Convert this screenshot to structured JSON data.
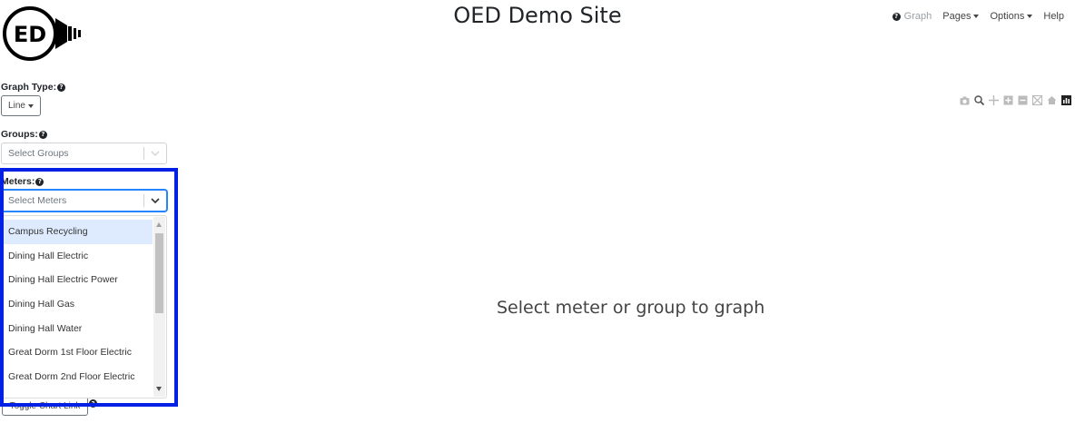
{
  "logo": {
    "text": "ED"
  },
  "header": {
    "title": "OED Demo Site"
  },
  "nav": {
    "items": [
      {
        "label": "Graph",
        "icon": "help-icon",
        "disabled": true
      },
      {
        "label": "Pages",
        "dropdown": true
      },
      {
        "label": "Options",
        "dropdown": true
      },
      {
        "label": "Help"
      }
    ]
  },
  "controls": {
    "graph_type_label": "Graph Type:",
    "graph_type_value": "Line",
    "groups_label": "Groups:",
    "groups_placeholder": "Select Groups",
    "meters_label": "Meters:",
    "meters_placeholder": "Select Meters",
    "meter_options": [
      "Campus Recycling",
      "Dining Hall Electric",
      "Dining Hall Electric Power",
      "Dining Hall Gas",
      "Dining Hall Water",
      "Great Dorm 1st Floor Electric",
      "Great Dorm 2nd Floor Electric"
    ],
    "highlighted_option": "Campus Recycling",
    "toggle_button_label": "Toggle Chart Link"
  },
  "main": {
    "placeholder": "Select meter or group to graph"
  },
  "toolbar": {
    "icons": [
      "camera-icon",
      "zoom-icon",
      "pan-icon",
      "zoom-in-icon",
      "zoom-out-icon",
      "autoscale-icon",
      "reset-axes-icon",
      "plotly-logo-icon"
    ]
  },
  "colors": {
    "highlight_frame": "#0021e5",
    "option_highlight": "#deebff",
    "focus_border": "#2684ff"
  }
}
